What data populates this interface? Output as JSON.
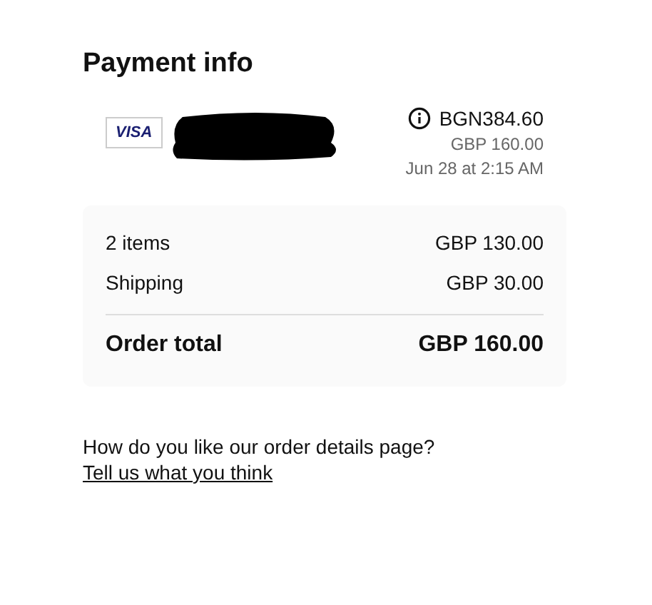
{
  "title": "Payment info",
  "payment": {
    "card_brand": "VISA",
    "redacted": true,
    "amount": "BGN384.60",
    "converted": "GBP 160.00",
    "date": "Jun 28 at 2:15 AM"
  },
  "summary": {
    "lines": [
      {
        "label": "2 items",
        "value": "GBP 130.00"
      },
      {
        "label": "Shipping",
        "value": "GBP 30.00"
      }
    ],
    "total": {
      "label": "Order total",
      "value": "GBP 160.00"
    }
  },
  "feedback": {
    "question": "How do you like our order details page?",
    "link": "Tell us what you think"
  }
}
